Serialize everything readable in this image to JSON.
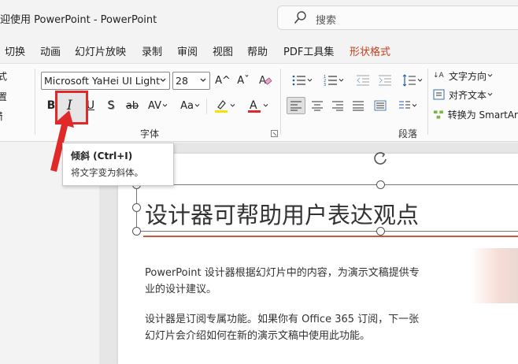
{
  "window": {
    "title": "欢迎使用 PowerPoint  -  PowerPoint",
    "search_placeholder": "搜索"
  },
  "menu_tabs": [
    {
      "label": "切换"
    },
    {
      "label": "动画"
    },
    {
      "label": "幻灯片放映"
    },
    {
      "label": "录制"
    },
    {
      "label": "审阅"
    },
    {
      "label": "视图"
    },
    {
      "label": "帮助"
    },
    {
      "label": "PDF工具集"
    },
    {
      "label": "形状格式",
      "accent": "#c43e1c"
    }
  ],
  "ribbon": {
    "left_stubs": [
      "式",
      "置",
      "节"
    ],
    "font": {
      "name": "Microsoft YaHei UI Light",
      "size": "28",
      "grow_label": "A^",
      "shrink_label": "Aˇ",
      "bold": "B",
      "italic": "I",
      "underline": "U",
      "shadow": "S",
      "strike": "ab",
      "spacing": "AV",
      "case": "Aa",
      "highlight_color": "#f5e200",
      "font_color": "#e02a2a",
      "group_label": "字体"
    },
    "paragraph": {
      "group_label": "段落",
      "text_direction": "文字方向",
      "align_text": "对齐文本",
      "convert_smartart": "转换为 SmartAr"
    }
  },
  "tooltip": {
    "title": "倾斜 (Ctrl+I)",
    "description": "将文字变为斜体。"
  },
  "slide": {
    "title": "设计器可帮助用户表达观点",
    "para1_line1": "PowerPoint 设计器根据幻灯片中的内容，为演示文稿提供专",
    "para1_line2": "业的设计建议。",
    "para2_line1": "设计器是订阅专属功能。如果你有 Office 365 订阅，下一张",
    "para2_line2": "幻灯片会介绍如何在新的演示文稿中使用此功能。",
    "accent_color": "#c85a3c"
  },
  "annotation": {
    "highlight_color": "#e02a2a"
  }
}
